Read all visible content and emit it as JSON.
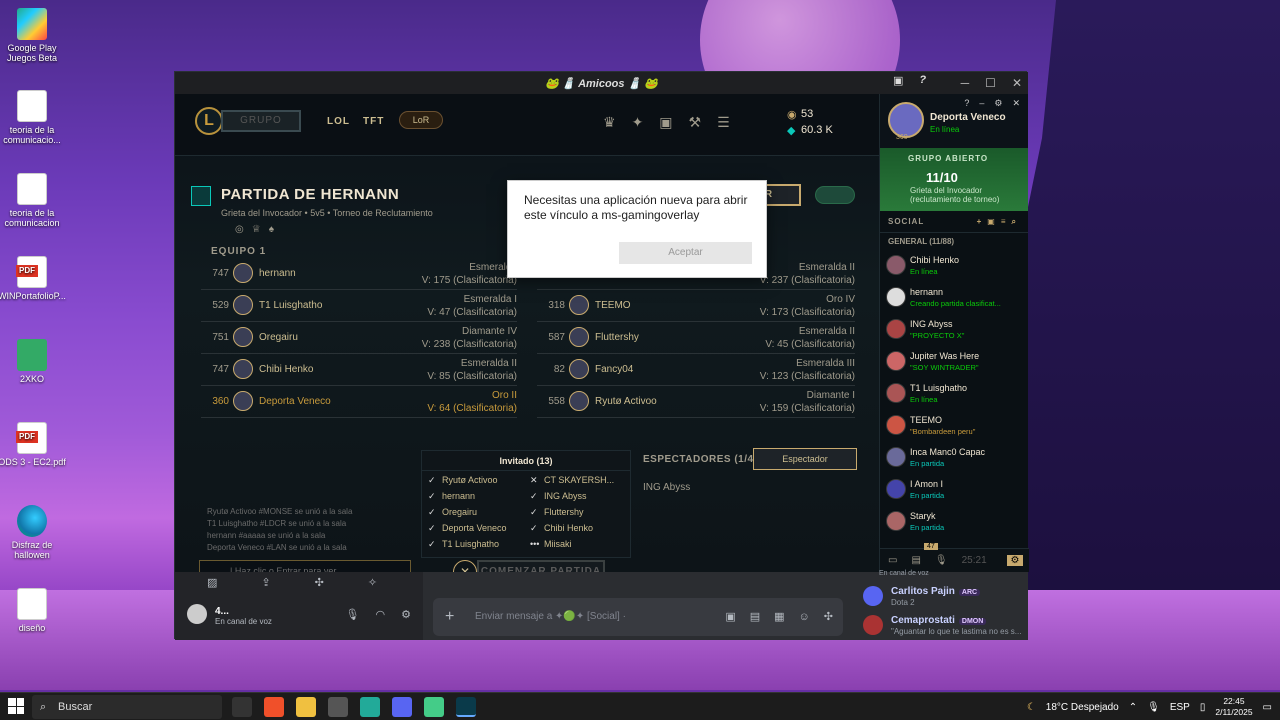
{
  "desktop_icons": [
    {
      "label": "Google Play Juegos Beta",
      "type": "gp"
    },
    {
      "label": "teoria de la comunicacio...",
      "type": "doc"
    },
    {
      "label": "teoria de la comunicacion",
      "type": "doc"
    },
    {
      "label": "WINPortafolioP...",
      "type": "pdf"
    },
    {
      "label": "2XKO",
      "type": "xko"
    },
    {
      "label": "ODS 3 - EC2.pdf",
      "type": "pdf"
    },
    {
      "label": "Disfraz de hallowen",
      "type": "edge"
    },
    {
      "label": "diseño",
      "type": "doc"
    }
  ],
  "window": {
    "title": "🐸 🧂 Amicoos 🧂 🐸"
  },
  "nav": {
    "logo": "L",
    "grupo": "GRUPO",
    "lol": "LOL",
    "tft": "TFT",
    "lor": "LoR",
    "rp": "53",
    "be": "60.3 K"
  },
  "party": {
    "title": "PARTIDA DE HERNANN",
    "map": "Grieta del Invocador",
    "mode": "5v5",
    "queue": "Torneo de Reclutamiento",
    "invite": "INVITAR",
    "team1": "EQUIPO 1"
  },
  "team1": [
    {
      "lp": "747",
      "name": "hernann",
      "rank": "Esmeralda",
      "sub": "V: 175 (Clasificatoria)"
    },
    {
      "lp": "529",
      "name": "T1 Luisghatho",
      "rank": "Esmeralda I",
      "sub": "V: 47 (Clasificatoria)"
    },
    {
      "lp": "751",
      "name": "Oregairu",
      "rank": "Diamante IV",
      "sub": "V: 238 (Clasificatoria)"
    },
    {
      "lp": "747",
      "name": "Chibi Henko",
      "rank": "Esmeralda II",
      "sub": "V: 85 (Clasificatoria)"
    },
    {
      "lp": "360",
      "name": "Deporta Veneco",
      "rank": "Oro II",
      "sub": "V: 64 (Clasificatoria)"
    }
  ],
  "team2": [
    {
      "lp": "",
      "name": "",
      "rank": "Esmeralda II",
      "sub": "V: 237 (Clasificatoria)"
    },
    {
      "lp": "318",
      "name": "TEEMO",
      "rank": "Oro IV",
      "sub": "V: 173 (Clasificatoria)"
    },
    {
      "lp": "587",
      "name": "Fluttershy",
      "rank": "Esmeralda II",
      "sub": "V: 45 (Clasificatoria)"
    },
    {
      "lp": "82",
      "name": "Fancy04",
      "rank": "Esmeralda III",
      "sub": "V: 123 (Clasificatoria)"
    },
    {
      "lp": "558",
      "name": "Ryutø Activoo",
      "rank": "Diamante I",
      "sub": "V: 159 (Clasificatoria)"
    }
  ],
  "invited": {
    "header": "Invitado (13)",
    "left": [
      "Ryutø Activoo",
      "hernann",
      "Oregairu",
      "Deporta Veneco",
      "T1 Luisghatho"
    ],
    "right": [
      "CT SKAYERSH...",
      "ING Abyss",
      "Fluttershy",
      "Chibi Henko",
      "Miisaki"
    ]
  },
  "spectators": {
    "title": "ESPECTADORES (1/4)",
    "button": "Espectador",
    "name": "ING Abyss"
  },
  "chatlog": [
    "Ryutø Activoo #MONSE se unió a la sala",
    "T1 Luisghatho #LDCR se unió a la sala",
    "hernann #aaaaa se unió a la sala",
    "Deporta Veneco #LAN se unió a la sala"
  ],
  "chat_placeholder": "| Haz clic o Entrar para ver",
  "start_button": "COMENZAR PARTIDA",
  "social": {
    "me": {
      "name": "Deporta Veneco",
      "status": "En línea",
      "level": "360"
    },
    "group": {
      "label": "GRUPO ABIERTO",
      "count": "11/10",
      "desc1": "Grieta del Invocador",
      "desc2": "(reclutamiento de torneo)"
    },
    "header": "SOCIAL",
    "general": "GENERAL (11/88)",
    "friends": [
      {
        "name": "Chibi Henko",
        "status": "En línea",
        "c": ""
      },
      {
        "name": "hernann",
        "status": "Creando partida clasificat...",
        "c": ""
      },
      {
        "name": "ING Abyss",
        "status": "\"PROYECTO X\"",
        "c": ""
      },
      {
        "name": "Jupiter Was Here",
        "status": "\"SOY WINTRADER\"",
        "c": ""
      },
      {
        "name": "T1 Luisghatho",
        "status": "En línea",
        "c": ""
      },
      {
        "name": "TEEMO",
        "status": "\"Bombardeen peru\"",
        "c": "y"
      },
      {
        "name": "Inca Manc0 Capac",
        "status": "En partida",
        "c": "b"
      },
      {
        "name": "I Amon I",
        "status": "En partida",
        "c": "b"
      },
      {
        "name": "Staryk",
        "status": "En partida",
        "c": "b"
      }
    ],
    "badge": "47",
    "time": "25:21"
  },
  "discord": {
    "user": "4...",
    "user_status": "En canal de voz",
    "msg_placeholder": "Enviar mensaje a ✦🟢✦ [Social] ·",
    "dms": [
      {
        "name": "Carlitos Pajin",
        "tag": "ARC",
        "status": "Dota 2"
      },
      {
        "name": "Cemaprostati",
        "tag": "DMON",
        "status": "\"Aguantar lo que te lastima no es s..."
      }
    ],
    "prev_status": "En canal de voz"
  },
  "dialog": {
    "message": "Necesitas una aplicación nueva para abrir este vínculo a ms-gamingoverlay",
    "button": "Aceptar"
  },
  "taskbar": {
    "search": "Buscar",
    "weather": "18°C  Despejado",
    "lang": "ESP",
    "time": "22:45",
    "date": "2/11/2025"
  }
}
